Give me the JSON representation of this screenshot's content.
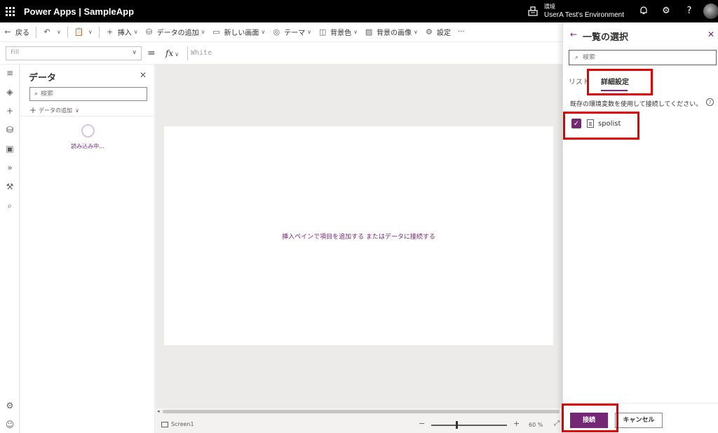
{
  "topbar": {
    "app_title": "Power Apps  |  SampleApp",
    "env_label": "環境",
    "env_name": "UserA Test's Environment"
  },
  "commandbar": {
    "back": "戻る",
    "insert": "挿入",
    "add_data": "データの追加",
    "new_screen": "新しい画面",
    "theme": "テーマ",
    "background_color": "背景色",
    "background_image": "背景の画像",
    "settings": "設定",
    "more": "···"
  },
  "formulabar": {
    "property": "Fill",
    "fx": "fx",
    "formula": "White"
  },
  "datapane": {
    "title": "データ",
    "search_placeholder": "検索",
    "add_data": "データの追加",
    "loading": "読み込み中..."
  },
  "canvas": {
    "hint": "挿入ペインで項目を追加する またはデータに接続する",
    "screen_name": "Screen1",
    "zoom": "60  %"
  },
  "rightpanel": {
    "title": "一覧の選択",
    "search_placeholder": "検索",
    "tab_list": "リスト",
    "tab_advanced": "詳細設定",
    "description": "既存の環境変数を使用して接続してください。",
    "help": "?",
    "item_label": "spolist",
    "connect": "接続",
    "cancel": "キャンセル"
  }
}
